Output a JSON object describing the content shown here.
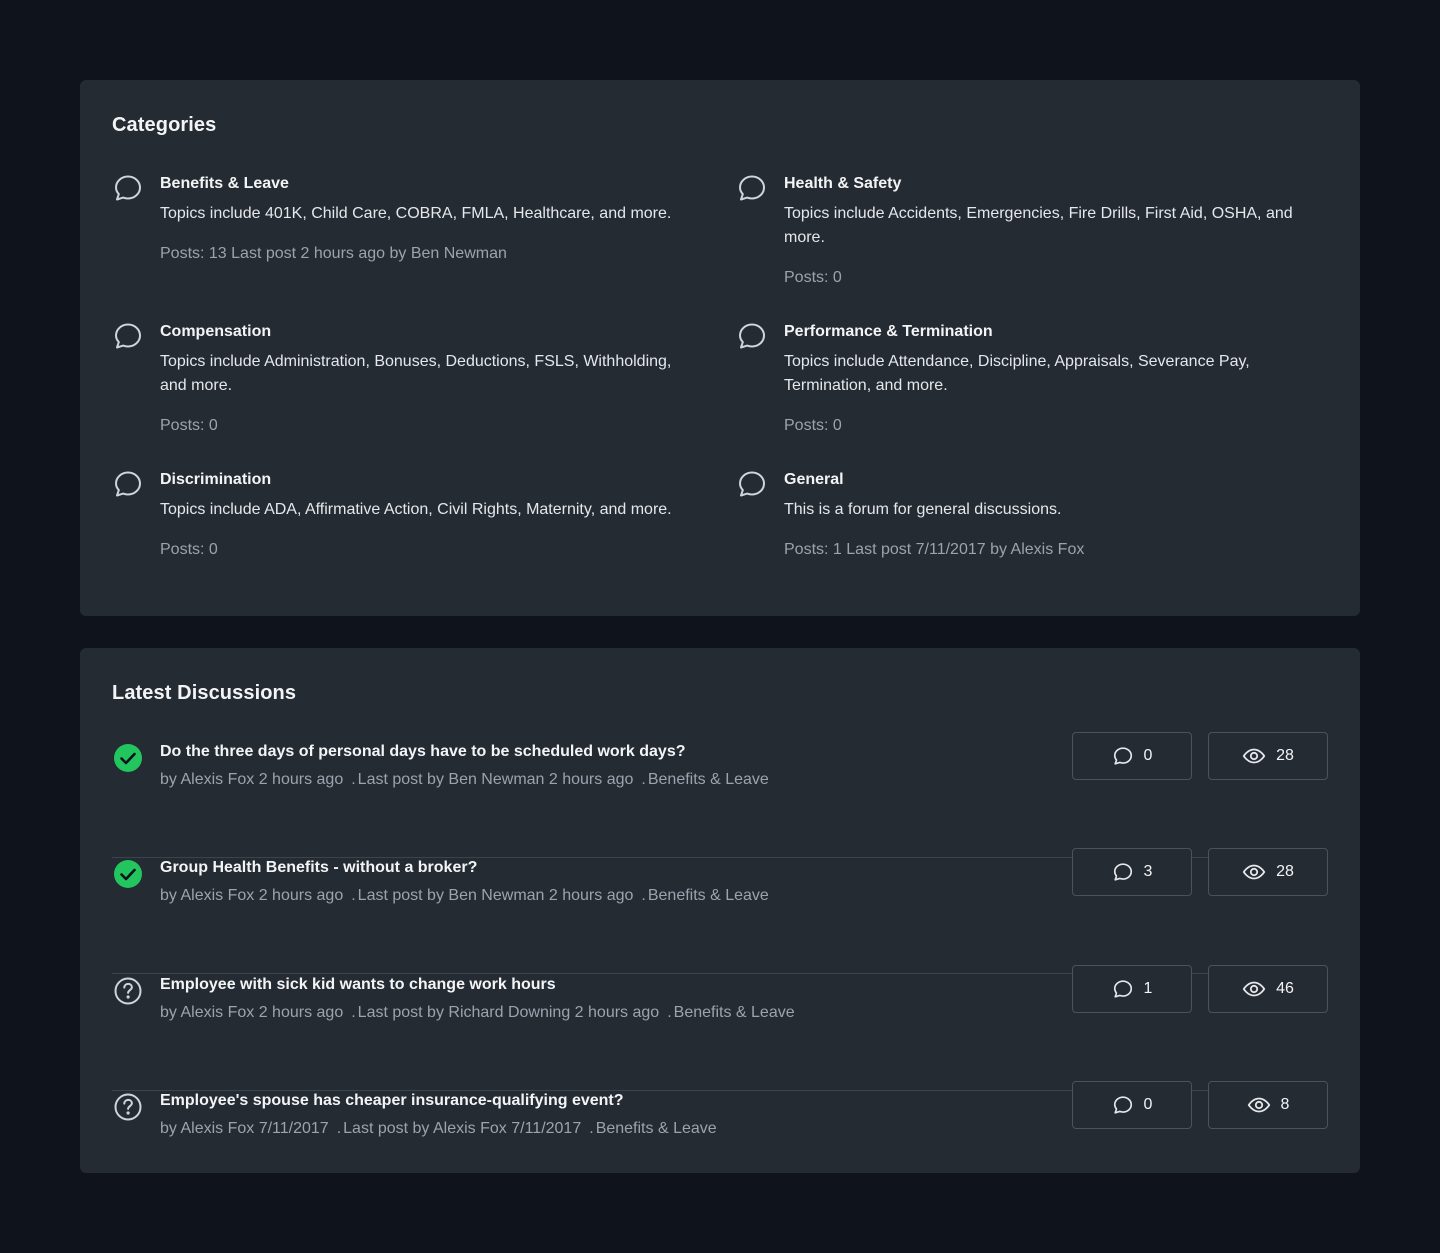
{
  "categories": {
    "title": "Categories",
    "items": [
      {
        "name": "Benefits & Leave",
        "description": "Topics include 401K, Child Care, COBRA, FMLA, Healthcare, and more.",
        "posts": "Posts: 13",
        "last_post": "Last post 2 hours ago by Ben Newman",
        "icon": "chat-bubble-icon"
      },
      {
        "name": "Health & Safety",
        "description": "Topics include Accidents, Emergencies, Fire Drills, First Aid, OSHA, and more.",
        "posts": "Posts: 0",
        "last_post": "",
        "icon": "chat-bubble-icon"
      },
      {
        "name": "Compensation",
        "description": "Topics include Administration, Bonuses, Deductions, FSLS, Withholding, and more.",
        "posts": "Posts: 0",
        "last_post": "",
        "icon": "chat-bubble-icon"
      },
      {
        "name": "Performance & Termination",
        "description": "Topics include Attendance, Discipline, Appraisals, Severance Pay, Termination, and more.",
        "posts": "Posts: 0",
        "last_post": "",
        "icon": "chat-bubble-icon"
      },
      {
        "name": "Discrimination",
        "description": "Topics include ADA, Affirmative Action, Civil Rights, Maternity, and more.",
        "posts": "Posts: 0",
        "last_post": "",
        "icon": "chat-bubble-icon"
      },
      {
        "name": "General",
        "description": "This is a forum for general discussions.",
        "posts": "Posts: 1",
        "last_post": "Last post 7/11/2017 by Alexis Fox",
        "icon": "chat-bubble-icon"
      }
    ]
  },
  "discussions": {
    "title": "Latest Discussions",
    "items": [
      {
        "title": "Do the three days of personal days have to be scheduled work days?",
        "author": "by Alexis Fox 2 hours ago",
        "last_post": "Last post by Ben Newman 2 hours ago",
        "category": "Benefits & Leave",
        "replies": "0",
        "views": "28",
        "status": "answered",
        "status_icon": "check-circle-icon"
      },
      {
        "title": "Group Health Benefits - without a broker?",
        "author": "by Alexis Fox 2 hours ago",
        "last_post": "Last post by Ben Newman 2 hours ago",
        "category": "Benefits & Leave",
        "replies": "3",
        "views": "28",
        "status": "answered",
        "status_icon": "check-circle-icon"
      },
      {
        "title": "Employee with sick kid wants to change work hours",
        "author": "by Alexis Fox 2 hours ago",
        "last_post": "Last post by Richard Downing 2 hours ago",
        "category": "Benefits & Leave",
        "replies": "1",
        "views": "46",
        "status": "question",
        "status_icon": "question-circle-icon"
      },
      {
        "title": "Employee's spouse has cheaper insurance-qualifying event?",
        "author": "by Alexis Fox 7/11/2017",
        "last_post": "Last post by Alexis Fox 7/11/2017",
        "category": "Benefits & Leave",
        "replies": "0",
        "views": "8",
        "status": "question",
        "status_icon": "question-circle-icon"
      }
    ]
  },
  "colors": {
    "page_bg": "#0f141c",
    "card_bg": "#242b32",
    "answered_green": "#22c55e",
    "muted_text": "#9ca3af"
  }
}
